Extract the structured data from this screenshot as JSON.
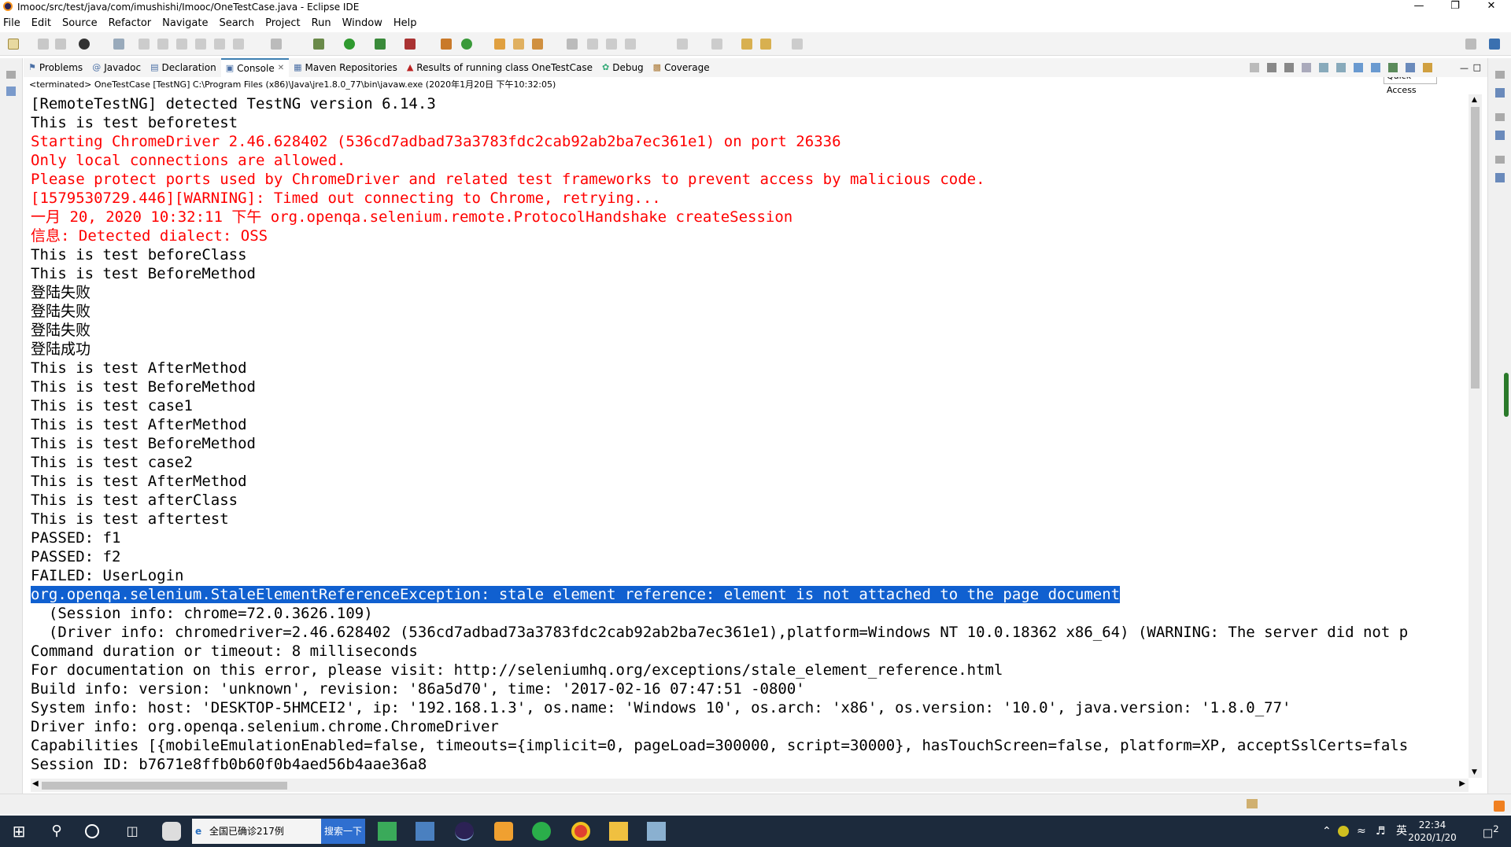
{
  "window": {
    "title": "Imooc/src/test/java/com/imushishi/Imooc/OneTestCase.java - Eclipse IDE"
  },
  "menu": [
    "File",
    "Edit",
    "Source",
    "Refactor",
    "Navigate",
    "Search",
    "Project",
    "Run",
    "Window",
    "Help"
  ],
  "quick_access": "Quick Access",
  "tabs": [
    {
      "label": "Problems",
      "icon": "problems-icon",
      "active": false
    },
    {
      "label": "Javadoc",
      "icon": "javadoc-icon",
      "active": false
    },
    {
      "label": "Declaration",
      "icon": "declaration-icon",
      "active": false
    },
    {
      "label": "Console",
      "icon": "console-icon",
      "active": true
    },
    {
      "label": "Maven Repositories",
      "icon": "maven-icon",
      "active": false
    },
    {
      "label": "Results of running class OneTestCase",
      "icon": "testng-icon",
      "active": false
    },
    {
      "label": "Debug",
      "icon": "debug-icon",
      "active": false
    },
    {
      "label": "Coverage",
      "icon": "coverage-icon",
      "active": false
    }
  ],
  "console_status": "<terminated> OneTestCase [TestNG] C:\\Program Files (x86)\\Java\\jre1.8.0_77\\bin\\javaw.exe (2020年1月20日 下午10:32:05)",
  "console_lines": [
    {
      "text": "[RemoteTestNG] detected TestNG version 6.14.3",
      "style": "normal"
    },
    {
      "text": "This is test beforetest",
      "style": "normal"
    },
    {
      "text": "Starting ChromeDriver 2.46.628402 (536cd7adbad73a3783fdc2cab92ab2ba7ec361e1) on port 26336",
      "style": "red"
    },
    {
      "text": "Only local connections are allowed.",
      "style": "red"
    },
    {
      "text": "Please protect ports used by ChromeDriver and related test frameworks to prevent access by malicious code.",
      "style": "red"
    },
    {
      "text": "[1579530729.446][WARNING]: Timed out connecting to Chrome, retrying...",
      "style": "red"
    },
    {
      "text": "一月 20, 2020 10:32:11 下午 org.openqa.selenium.remote.ProtocolHandshake createSession",
      "style": "red"
    },
    {
      "text": "信息: Detected dialect: OSS",
      "style": "red"
    },
    {
      "text": "This is test beforeClass",
      "style": "normal"
    },
    {
      "text": "This is test BeforeMethod",
      "style": "normal"
    },
    {
      "text": "登陆失败",
      "style": "normal"
    },
    {
      "text": "登陆失败",
      "style": "normal"
    },
    {
      "text": "登陆失败",
      "style": "normal"
    },
    {
      "text": "登陆成功",
      "style": "normal"
    },
    {
      "text": "This is test AfterMethod",
      "style": "normal"
    },
    {
      "text": "This is test BeforeMethod",
      "style": "normal"
    },
    {
      "text": "This is test case1",
      "style": "normal"
    },
    {
      "text": "This is test AfterMethod",
      "style": "normal"
    },
    {
      "text": "This is test BeforeMethod",
      "style": "normal"
    },
    {
      "text": "This is test case2",
      "style": "normal"
    },
    {
      "text": "This is test AfterMethod",
      "style": "normal"
    },
    {
      "text": "This is test afterClass",
      "style": "normal"
    },
    {
      "text": "This is test aftertest",
      "style": "normal"
    },
    {
      "text": "PASSED: f1",
      "style": "normal"
    },
    {
      "text": "PASSED: f2",
      "style": "normal"
    },
    {
      "text": "FAILED: UserLogin",
      "style": "normal"
    },
    {
      "text": "org.openqa.selenium.StaleElementReferenceException: stale element reference: element is not attached to the page document",
      "style": "selected"
    },
    {
      "text": "  (Session info: chrome=72.0.3626.109)",
      "style": "normal"
    },
    {
      "text": "  (Driver info: chromedriver=2.46.628402 (536cd7adbad73a3783fdc2cab92ab2ba7ec361e1),platform=Windows NT 10.0.18362 x86_64) (WARNING: The server did not p",
      "style": "normal"
    },
    {
      "text": "Command duration or timeout: 8 milliseconds",
      "style": "normal"
    },
    {
      "text": "For documentation on this error, please visit: http://seleniumhq.org/exceptions/stale_element_reference.html",
      "style": "normal"
    },
    {
      "text": "Build info: version: 'unknown', revision: '86a5d70', time: '2017-02-16 07:47:51 -0800'",
      "style": "normal"
    },
    {
      "text": "System info: host: 'DESKTOP-5HMCEI2', ip: '192.168.1.3', os.name: 'Windows 10', os.arch: 'x86', os.version: '10.0', java.version: '1.8.0_77'",
      "style": "normal"
    },
    {
      "text": "Driver info: org.openqa.selenium.chrome.ChromeDriver",
      "style": "normal"
    },
    {
      "text": "Capabilities [{mobileEmulationEnabled=false, timeouts={implicit=0, pageLoad=300000, script=30000}, hasTouchScreen=false, platform=XP, acceptSslCerts=fals",
      "style": "normal"
    },
    {
      "text": "Session ID: b7671e8ffb0b60f0b4aed56b4aae36a8",
      "style": "normal"
    }
  ],
  "taskbar": {
    "search_text": "全国已确诊217例",
    "search_button": "搜索一下",
    "ime": "英",
    "time": "22:34",
    "date": "2020/1/20",
    "notifications": "2"
  },
  "colors": {
    "error": "#ff0000",
    "selection": "#1060d0",
    "active_tab": "#3c7fb1",
    "taskbar": "#1c2a3c"
  }
}
